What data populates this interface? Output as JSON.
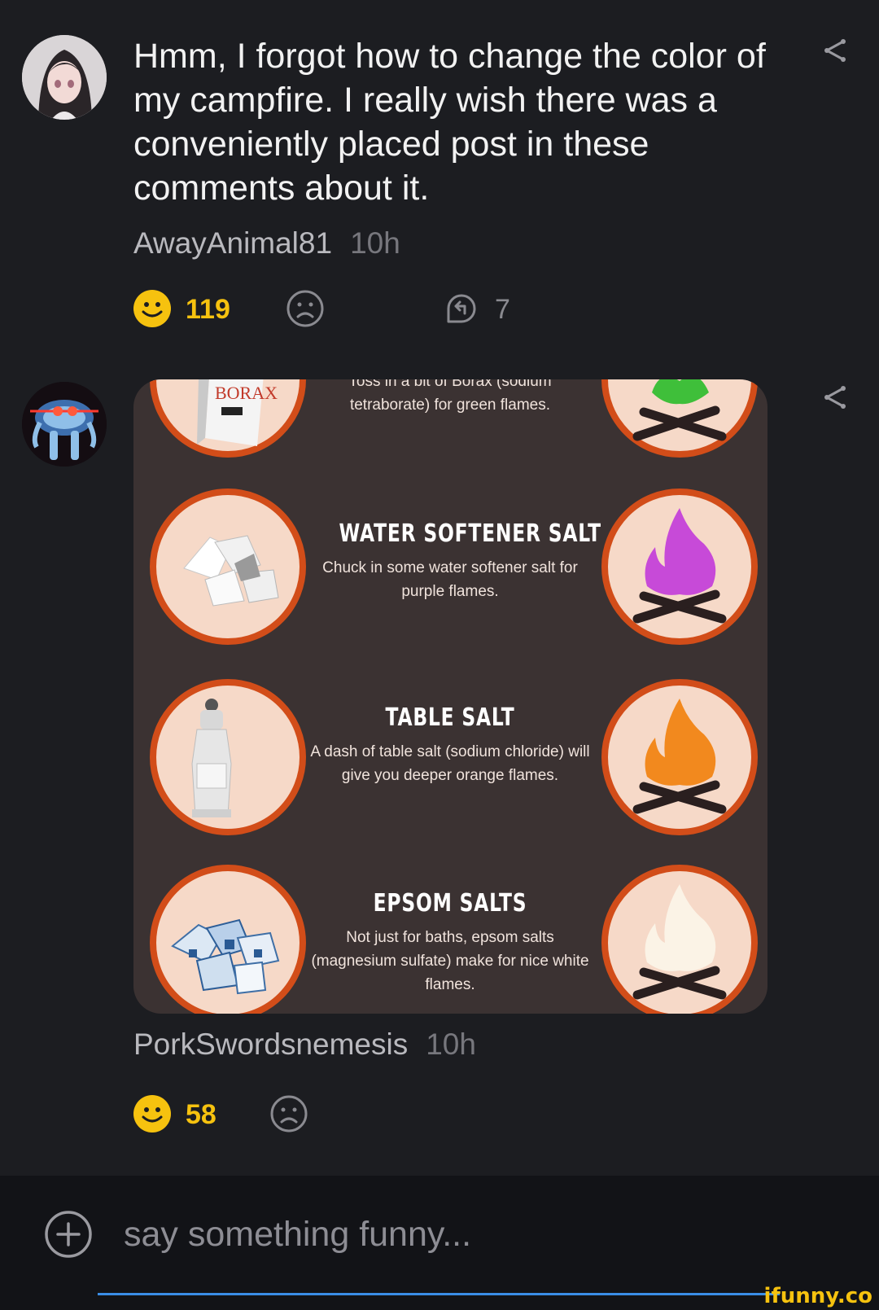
{
  "comments": [
    {
      "text": "Hmm, I forgot how to change the color of my campfire. I really wish there was a conveniently placed post in these comments about it.",
      "username": "AwayAnimal81",
      "time": "10h",
      "smile_count": "119",
      "reply_count": "7"
    },
    {
      "username": "PorkSwordsnemesis",
      "time": "10h",
      "smile_count": "58",
      "infographic": {
        "rows": [
          {
            "title": "",
            "desc": "Toss in a bit of Borax (sodium tetraborate) for green flames.",
            "box_label": "BORAX",
            "flame_color": "#3fbf3a"
          },
          {
            "title": "WATER SOFTENER SALT",
            "desc": "Chuck in some water softener salt for purple flames.",
            "flame_color": "#c74ad8"
          },
          {
            "title": "TABLE SALT",
            "desc": "A dash of table salt (sodium chloride) will give you deeper orange flames.",
            "flame_color": "#f2891e"
          },
          {
            "title": "EPSOM SALTS",
            "desc": "Not just for baths, epsom salts (magnesium sulfate) make for nice white flames.",
            "flame_color": "#fbf3e6"
          }
        ]
      }
    }
  ],
  "input": {
    "placeholder": "say something funny..."
  },
  "watermark": "ifunny.co",
  "colors": {
    "accent": "#f6c20f",
    "background": "#1c1d21",
    "input_line": "#3a8de6"
  }
}
